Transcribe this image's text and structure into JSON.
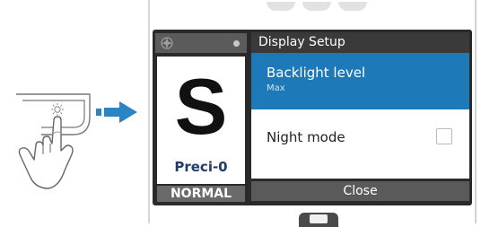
{
  "left_panel": {
    "mode_letter": "S",
    "mode_name": "Preci-0",
    "state": "NORMAL"
  },
  "dialog": {
    "title": "Display Setup",
    "items": [
      {
        "label": "Backlight level",
        "value": "Max",
        "selected": true
      },
      {
        "label": "Night mode",
        "checked": false
      }
    ],
    "close_label": "Close"
  },
  "icons": {
    "header_left": "compass-icon",
    "header_right": "dot-icon",
    "hand": "hand-pressing-icon",
    "arrow": "arrow-right-icon"
  },
  "colors": {
    "accent": "#1e79b8",
    "arrow": "#2b84c4",
    "screen_bg": "#2a2a2a"
  }
}
